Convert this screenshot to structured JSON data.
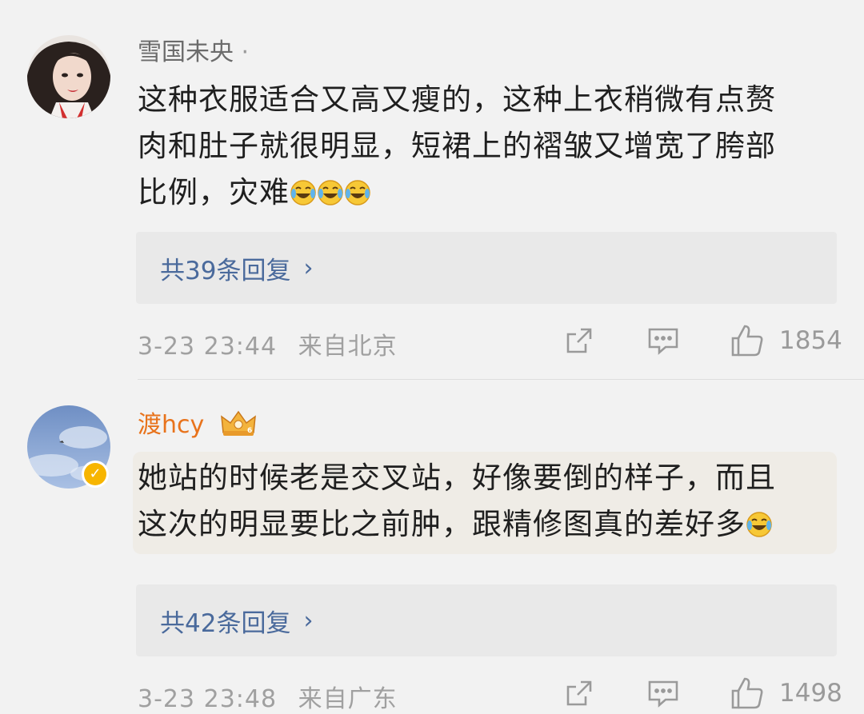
{
  "comments": [
    {
      "username": "雪国未央",
      "username_dot": "·",
      "text_line1": "这种衣服适合又高又瘦的，这种上衣稍微有点赘",
      "text_line2": "肉和肚子就很明显，短裙上的褶皱又增宽了胯部",
      "text_line3": "比例，灾难",
      "emoji_count": 3,
      "reply_label": "共39条回复",
      "date": "3-23 23:44",
      "location": "来自北京",
      "likes": "1854"
    },
    {
      "username": "渡hcy",
      "badge": "crown-badge",
      "verified": true,
      "text_line1": "她站的时候老是交叉站，好像要倒的样子，而且",
      "text_line2": "这次的明显要比之前肿，跟精修图真的差好多",
      "reply_label": "共42条回复",
      "date": "3-23 23:48",
      "location": "来自广东",
      "likes": "1498"
    }
  ],
  "colors": {
    "background": "#f2f2f2",
    "vip_name": "#e8731c",
    "link": "#4a6a9c",
    "verified": "#f7b500"
  },
  "icons": [
    "share-icon",
    "comment-icon",
    "like-icon",
    "laugh-cry-emoji",
    "crown-badge",
    "verified-badge"
  ]
}
